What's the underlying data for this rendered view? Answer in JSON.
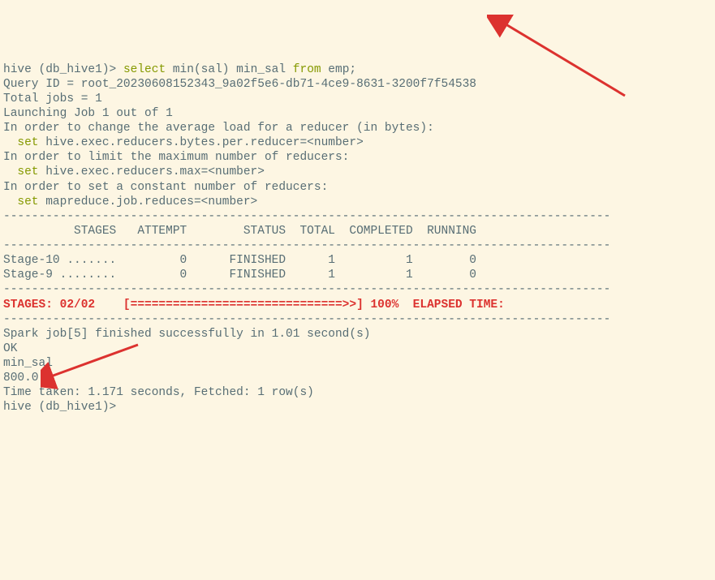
{
  "lines": {
    "l01a": "hive (db_hive1)> ",
    "l01b": "select",
    "l01c": " min(sal) min_sal ",
    "l01d": "from",
    "l01e": " emp;",
    "l02": "Query ID = root_20230608152343_9a02f5e6-db71-4ce9-8631-3200f7f54538",
    "l03": "Total jobs = 1",
    "l04": "Launching Job 1 out of 1",
    "l05": "In order to change the average load for a reducer (in bytes):",
    "l06a": "  ",
    "l06b": "set",
    "l06c": " hive.exec.reducers.bytes.per.reducer=<number>",
    "l07": "In order to limit the maximum number of reducers:",
    "l08a": "  ",
    "l08b": "set",
    "l08c": " hive.exec.reducers.max=<number>",
    "l09": "In order to set a constant number of reducers:",
    "l10a": "  ",
    "l10b": "set",
    "l10c": " mapreduce.job.reduces=<number>",
    "dash1": "--------------------------------------------------------------------------------------",
    "hdr": "          STAGES   ATTEMPT        STATUS  TOTAL  COMPLETED  RUNNING",
    "dash2": "--------------------------------------------------------------------------------------",
    "row1": "Stage-10 .......         0      FINISHED      1          1        0",
    "row2": "Stage-9 ........         0      FINISHED      1          1        0",
    "dash3": "--------------------------------------------------------------------------------------",
    "prog": "STAGES: 02/02    [==============================>>] 100%  ELAPSED TIME:",
    "dash4": "--------------------------------------------------------------------------------------",
    "fin": "Spark job[5] finished successfully in 1.01 second(s)",
    "ok": "OK",
    "col": "min_sal",
    "val": "800.0",
    "time": "Time taken: 1.171 seconds, Fetched: 1 row(s)",
    "prompt2": "hive (db_hive1)> "
  }
}
